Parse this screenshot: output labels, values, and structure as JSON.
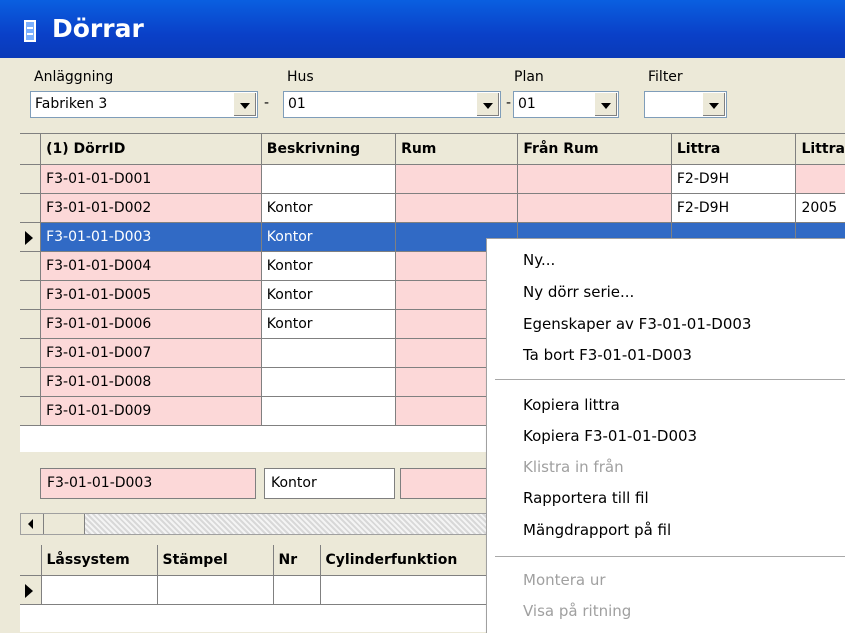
{
  "window": {
    "title": "Dörrar"
  },
  "filters": {
    "anlaggning": {
      "label": "Anläggning",
      "value": "Fabriken 3"
    },
    "hus": {
      "label": "Hus",
      "value": "01"
    },
    "plan": {
      "label": "Plan",
      "value": "01"
    },
    "filter": {
      "label": "Filter",
      "value": ""
    },
    "dash": "-"
  },
  "table": {
    "columns": [
      "(1) DörrID",
      "Beskrivning",
      "Rum",
      "Från Rum",
      "Littra",
      "Littra"
    ],
    "rows": [
      [
        "F3-01-01-D001",
        "",
        "",
        "",
        "F2-D9H",
        ""
      ],
      [
        "F3-01-01-D002",
        "Kontor",
        "",
        "",
        "F2-D9H",
        "2005"
      ],
      [
        "F3-01-01-D003",
        "Kontor",
        "",
        "",
        "",
        ""
      ],
      [
        "F3-01-01-D004",
        "Kontor",
        "",
        "",
        "",
        ""
      ],
      [
        "F3-01-01-D005",
        "Kontor",
        "",
        "",
        "",
        ""
      ],
      [
        "F3-01-01-D006",
        "Kontor",
        "",
        "",
        "",
        ""
      ],
      [
        "F3-01-01-D007",
        "",
        "",
        "",
        "",
        ""
      ],
      [
        "F3-01-01-D008",
        "",
        "",
        "",
        "",
        ""
      ],
      [
        "F3-01-01-D009",
        "",
        "",
        "",
        "",
        ""
      ]
    ]
  },
  "detail": {
    "id": "F3-01-01-D003",
    "desc": "Kontor"
  },
  "bottom_table": {
    "columns": [
      "Låssystem",
      "Stämpel",
      "Nr",
      "Cylinderfunktion"
    ]
  },
  "context_menu": {
    "items": [
      {
        "label": "Ny...",
        "disabled": false
      },
      {
        "label": "Ny dörr serie...",
        "disabled": false
      },
      {
        "label": "Egenskaper av F3-01-01-D003",
        "disabled": false
      },
      {
        "label": "Ta bort F3-01-01-D003",
        "disabled": false
      },
      {
        "label": "Kopiera littra",
        "disabled": false
      },
      {
        "label": "Kopiera F3-01-01-D003",
        "disabled": false
      },
      {
        "label": "Klistra in från",
        "disabled": true
      },
      {
        "label": "Rapportera till fil",
        "disabled": false
      },
      {
        "label": "Mängdrapport på fil",
        "disabled": false
      },
      {
        "label": "Montera ur",
        "disabled": true
      },
      {
        "label": "Visa på ritning",
        "disabled": true
      }
    ]
  },
  "colors": {
    "title_bar": "#0a4fd8",
    "selection": "#316ac5",
    "pink_cell": "#fcd8d8"
  }
}
